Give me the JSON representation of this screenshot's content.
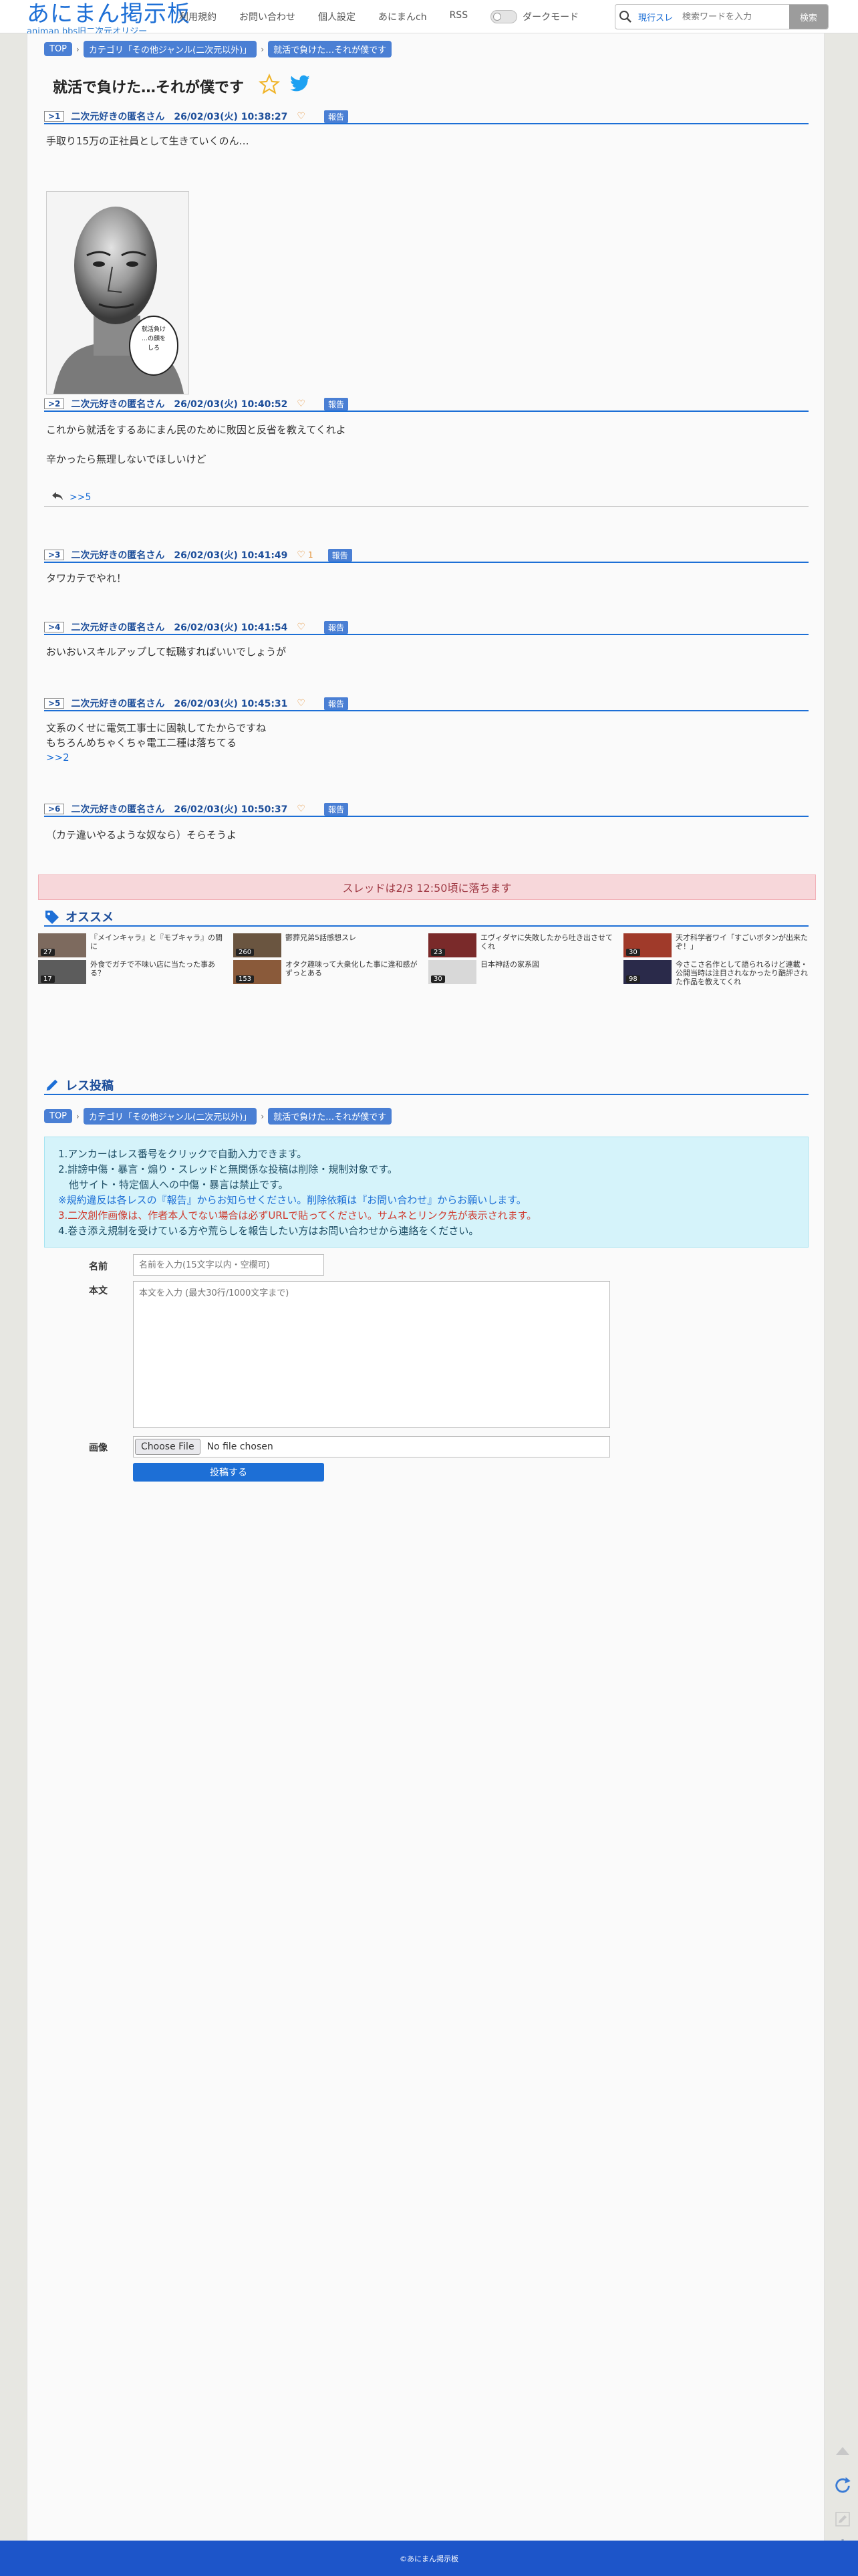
{
  "header": {
    "logo_main": "あにまん掲示板",
    "logo_sub": "animan bbs旧二次元オリジー",
    "nav": [
      {
        "label": "利用規約"
      },
      {
        "label": "お問い合わせ"
      },
      {
        "label": "個人設定"
      },
      {
        "label": "あにまんch"
      },
      {
        "label": "RSS"
      }
    ],
    "dark_mode_label": "ダークモード",
    "search": {
      "mode_label": "現行スレ",
      "placeholder": "検索ワードを入力",
      "button_label": "検索"
    }
  },
  "breadcrumb": [
    {
      "label": "TOP"
    },
    {
      "label": "カテゴリ「その他ジャンル(二次元以外)」"
    },
    {
      "label": "就活で負けた…それが僕です"
    }
  ],
  "thread": {
    "title": "就活で負けた…それが僕です",
    "report_label": "報告",
    "posts": [
      {
        "num": ">1",
        "name": "二次元好きの匿名さん",
        "date": "26/02/03(火) 10:38:27",
        "likes": "",
        "body": [
          "手取り15万の正社員として生きていくのん…"
        ],
        "has_image": true
      },
      {
        "num": ">2",
        "name": "二次元好きの匿名さん",
        "date": "26/02/03(火) 10:40:52",
        "likes": "",
        "body": [
          "これから就活をするあにまん民のために敗因と反省を教えてくれよ",
          "",
          "辛かったら無理しないでほしいけど"
        ],
        "reply": ">>5"
      },
      {
        "num": ">3",
        "name": "二次元好きの匿名さん",
        "date": "26/02/03(火) 10:41:49",
        "likes": "1",
        "body": [
          "タワカテでやれ！"
        ]
      },
      {
        "num": ">4",
        "name": "二次元好きの匿名さん",
        "date": "26/02/03(火) 10:41:54",
        "likes": "",
        "body": [
          "おいおいスキルアップして転職すればいいでしょうが"
        ]
      },
      {
        "num": ">5",
        "name": "二次元好きの匿名さん",
        "date": "26/02/03(火) 10:45:31",
        "likes": "",
        "body": [
          "文系のくせに電気工事士に固執してたからですね",
          "もちろんめちゃくちゃ電工二種は落ちてる"
        ],
        "anchor": ">>2"
      },
      {
        "num": ">6",
        "name": "二次元好きの匿名さん",
        "date": "26/02/03(火) 10:50:37",
        "likes": "",
        "body": [
          "（カテ違いやるような奴なら）そらそうよ"
        ]
      }
    ],
    "image_caption": "就活負け…の顔をしろ"
  },
  "expiry_notice": "スレッドは2/3 12:50頃に落ちます",
  "recommend": {
    "heading": "オススメ",
    "items": [
      {
        "count": "27",
        "text": "『メインキャラ』と『モブキャラ』の間に"
      },
      {
        "count": "17",
        "text": "外食でガチで不味い店に当たった事ある？"
      },
      {
        "count": "260",
        "text": "鬱葬兄弟5話感想スレ"
      },
      {
        "count": "153",
        "text": "オタク趣味って大衆化した事に違和感がずっとある"
      },
      {
        "count": "23",
        "text": "エヴィダヤに失敗したから吐き出させてくれ"
      },
      {
        "count": "30",
        "text": "日本神話の家系図"
      },
      {
        "count": "30",
        "text": "天才科学者ワイ「すごいボタンが出来たぞ！」"
      },
      {
        "count": "98",
        "text": "今さこさ名作として語られるけど連載・公開当時は注目されなかったり酷評された作品を教えてくれ"
      }
    ]
  },
  "reply_form": {
    "heading": "レス投稿",
    "rules": [
      "1.アンカーはレス番号をクリックで自動入力できます。",
      "2.誹謗中傷・暴言・煽り・スレッドと無関係な投稿は削除・規制対象です。",
      "他サイト・特定個人への中傷・暴言は禁止です。",
      "※規約違反は各レスの『報告』からお知らせください。削除依頼は『お問い合わせ』からお願いします。",
      "3.二次創作画像は、作者本人でない場合は必ずURLで貼ってください。サムネとリンク先が表示されます。",
      "4.巻き添え規制を受けている方や荒らしを報告したい方はお問い合わせから連絡をください。"
    ],
    "name_label": "名前",
    "name_placeholder": "名前を入力(15文字以内・空欄可)",
    "body_label": "本文",
    "body_placeholder": "本文を入力 (最大30行/1000文字まで)",
    "image_label": "画像",
    "file_button": "Choose File",
    "file_status": "No file chosen",
    "submit_label": "投稿する"
  },
  "footer": {
    "copyright": "©あにまん掲示板"
  },
  "colors": {
    "accent": "#1d6fd6",
    "report_badge": "#4a7fd4",
    "expiry_bg": "#f7d7da",
    "rules_bg": "#d5f3fa",
    "footer_bg": "#1d55c9"
  }
}
